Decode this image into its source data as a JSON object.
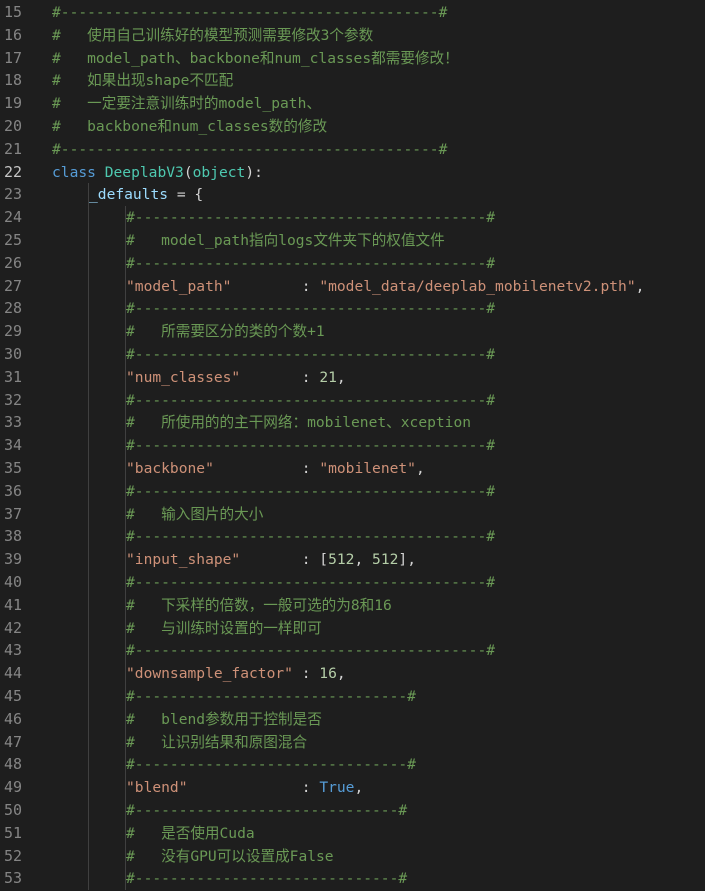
{
  "theme": {
    "background": "#1e1e1e",
    "line_number": "#858585",
    "line_number_active": "#c6c6c6",
    "comment": "#6a9955",
    "keyword": "#569cd6",
    "class_name": "#4ec9b0",
    "string": "#ce9178",
    "number": "#b5cea8",
    "variable": "#9cdcfe",
    "punctuation": "#d4d4d4"
  },
  "editor": {
    "active_line": 22,
    "lines": [
      {
        "n": 15,
        "indent": 0,
        "tokens": [
          {
            "t": "com",
            "v": "#-------------------------------------------#"
          }
        ]
      },
      {
        "n": 16,
        "indent": 0,
        "tokens": [
          {
            "t": "com",
            "v": "#   使用自己训练好的模型预测需要修改3个参数"
          }
        ]
      },
      {
        "n": 17,
        "indent": 0,
        "tokens": [
          {
            "t": "com",
            "v": "#   model_path、backbone和num_classes都需要修改！"
          }
        ]
      },
      {
        "n": 18,
        "indent": 0,
        "tokens": [
          {
            "t": "com",
            "v": "#   如果出现shape不匹配"
          }
        ]
      },
      {
        "n": 19,
        "indent": 0,
        "tokens": [
          {
            "t": "com",
            "v": "#   一定要注意训练时的model_path、"
          }
        ]
      },
      {
        "n": 20,
        "indent": 0,
        "tokens": [
          {
            "t": "com",
            "v": "#   backbone和num_classes数的修改"
          }
        ]
      },
      {
        "n": 21,
        "indent": 0,
        "tokens": [
          {
            "t": "com",
            "v": "#-------------------------------------------#"
          }
        ]
      },
      {
        "n": 22,
        "indent": 0,
        "tokens": [
          {
            "t": "kw",
            "v": "class"
          },
          {
            "t": "pun",
            "v": " "
          },
          {
            "t": "cls",
            "v": "DeeplabV3"
          },
          {
            "t": "pun",
            "v": "("
          },
          {
            "t": "cls",
            "v": "object"
          },
          {
            "t": "pun",
            "v": "):"
          }
        ]
      },
      {
        "n": 23,
        "indent": 1,
        "tokens": [
          {
            "t": "var",
            "v": "_defaults"
          },
          {
            "t": "pun",
            "v": " = {"
          }
        ]
      },
      {
        "n": 24,
        "indent": 2,
        "tokens": [
          {
            "t": "com",
            "v": "#----------------------------------------#"
          }
        ]
      },
      {
        "n": 25,
        "indent": 2,
        "tokens": [
          {
            "t": "com",
            "v": "#   model_path指向logs文件夹下的权值文件"
          }
        ]
      },
      {
        "n": 26,
        "indent": 2,
        "tokens": [
          {
            "t": "com",
            "v": "#----------------------------------------#"
          }
        ]
      },
      {
        "n": 27,
        "indent": 2,
        "tokens": [
          {
            "t": "str",
            "v": "\"model_path\""
          },
          {
            "t": "pun",
            "v": "        : "
          },
          {
            "t": "str",
            "v": "\"model_data/deeplab_mobilenetv2.pth\""
          },
          {
            "t": "pun",
            "v": ","
          }
        ]
      },
      {
        "n": 28,
        "indent": 2,
        "tokens": [
          {
            "t": "com",
            "v": "#----------------------------------------#"
          }
        ]
      },
      {
        "n": 29,
        "indent": 2,
        "tokens": [
          {
            "t": "com",
            "v": "#   所需要区分的类的个数+1"
          }
        ]
      },
      {
        "n": 30,
        "indent": 2,
        "tokens": [
          {
            "t": "com",
            "v": "#----------------------------------------#"
          }
        ]
      },
      {
        "n": 31,
        "indent": 2,
        "tokens": [
          {
            "t": "str",
            "v": "\"num_classes\""
          },
          {
            "t": "pun",
            "v": "       : "
          },
          {
            "t": "num",
            "v": "21"
          },
          {
            "t": "pun",
            "v": ","
          }
        ]
      },
      {
        "n": 32,
        "indent": 2,
        "tokens": [
          {
            "t": "com",
            "v": "#----------------------------------------#"
          }
        ]
      },
      {
        "n": 33,
        "indent": 2,
        "tokens": [
          {
            "t": "com",
            "v": "#   所使用的的主干网络：mobilenet、xception"
          }
        ]
      },
      {
        "n": 34,
        "indent": 2,
        "tokens": [
          {
            "t": "com",
            "v": "#----------------------------------------#"
          }
        ]
      },
      {
        "n": 35,
        "indent": 2,
        "tokens": [
          {
            "t": "str",
            "v": "\"backbone\""
          },
          {
            "t": "pun",
            "v": "          : "
          },
          {
            "t": "str",
            "v": "\"mobilenet\""
          },
          {
            "t": "pun",
            "v": ","
          }
        ]
      },
      {
        "n": 36,
        "indent": 2,
        "tokens": [
          {
            "t": "com",
            "v": "#----------------------------------------#"
          }
        ]
      },
      {
        "n": 37,
        "indent": 2,
        "tokens": [
          {
            "t": "com",
            "v": "#   输入图片的大小"
          }
        ]
      },
      {
        "n": 38,
        "indent": 2,
        "tokens": [
          {
            "t": "com",
            "v": "#----------------------------------------#"
          }
        ]
      },
      {
        "n": 39,
        "indent": 2,
        "tokens": [
          {
            "t": "str",
            "v": "\"input_shape\""
          },
          {
            "t": "pun",
            "v": "       : ["
          },
          {
            "t": "num",
            "v": "512"
          },
          {
            "t": "pun",
            "v": ", "
          },
          {
            "t": "num",
            "v": "512"
          },
          {
            "t": "pun",
            "v": "],"
          }
        ]
      },
      {
        "n": 40,
        "indent": 2,
        "tokens": [
          {
            "t": "com",
            "v": "#----------------------------------------#"
          }
        ]
      },
      {
        "n": 41,
        "indent": 2,
        "tokens": [
          {
            "t": "com",
            "v": "#   下采样的倍数，一般可选的为8和16"
          }
        ]
      },
      {
        "n": 42,
        "indent": 2,
        "tokens": [
          {
            "t": "com",
            "v": "#   与训练时设置的一样即可"
          }
        ]
      },
      {
        "n": 43,
        "indent": 2,
        "tokens": [
          {
            "t": "com",
            "v": "#----------------------------------------#"
          }
        ]
      },
      {
        "n": 44,
        "indent": 2,
        "tokens": [
          {
            "t": "str",
            "v": "\"downsample_factor\""
          },
          {
            "t": "pun",
            "v": " : "
          },
          {
            "t": "num",
            "v": "16"
          },
          {
            "t": "pun",
            "v": ","
          }
        ]
      },
      {
        "n": 45,
        "indent": 2,
        "tokens": [
          {
            "t": "com",
            "v": "#-------------------------------#"
          }
        ]
      },
      {
        "n": 46,
        "indent": 2,
        "tokens": [
          {
            "t": "com",
            "v": "#   blend参数用于控制是否"
          }
        ]
      },
      {
        "n": 47,
        "indent": 2,
        "tokens": [
          {
            "t": "com",
            "v": "#   让识别结果和原图混合"
          }
        ]
      },
      {
        "n": 48,
        "indent": 2,
        "tokens": [
          {
            "t": "com",
            "v": "#-------------------------------#"
          }
        ]
      },
      {
        "n": 49,
        "indent": 2,
        "tokens": [
          {
            "t": "str",
            "v": "\"blend\""
          },
          {
            "t": "pun",
            "v": "             : "
          },
          {
            "t": "kw",
            "v": "True"
          },
          {
            "t": "pun",
            "v": ","
          }
        ]
      },
      {
        "n": 50,
        "indent": 2,
        "tokens": [
          {
            "t": "com",
            "v": "#------------------------------#"
          }
        ]
      },
      {
        "n": 51,
        "indent": 2,
        "tokens": [
          {
            "t": "com",
            "v": "#   是否使用Cuda"
          }
        ]
      },
      {
        "n": 52,
        "indent": 2,
        "tokens": [
          {
            "t": "com",
            "v": "#   没有GPU可以设置成False"
          }
        ]
      },
      {
        "n": 53,
        "indent": 2,
        "tokens": [
          {
            "t": "com",
            "v": "#------------------------------#"
          }
        ]
      }
    ]
  }
}
